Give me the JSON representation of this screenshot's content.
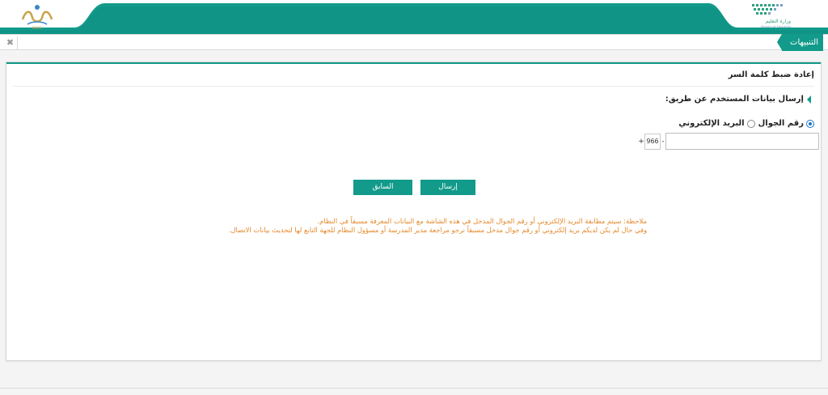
{
  "header": {
    "left_logo_label": "NOOR",
    "right_logo_ar": "وزارة التعليم",
    "right_logo_en": "Ministry of Education",
    "accent_color": "#129a8a"
  },
  "tabs": {
    "close_symbol": "✖",
    "active_tab_label": "التنبيهات"
  },
  "panel": {
    "title": "إعادة ضبط كلمة السر",
    "section_label": "إرسال بيانات المستخدم عن طريق:",
    "options": {
      "mobile": "رقم الجوال",
      "email": "البريد الإلكتروني"
    },
    "phone": {
      "plus": "+",
      "prefix": "966",
      "dash": "-",
      "value": "",
      "placeholder": ""
    },
    "buttons": {
      "send": "إرسال",
      "previous": "السابق"
    },
    "notes": [
      "ملاحظة: سيتم مطابقة البريد الإلكتروني أو رقم الجوال المدخل في هذه الشاشة مع البيانات المعرفة مسبقاً في النظام.",
      "وفي حال لم يكن لديكم بريد إلكتروني أو رقم جوال مدخل مسبقاً نرجو مراجعة مدير المدرسة أو مسؤول النظام للجهة التابع لها لتحديث بيانات الاتصال."
    ]
  }
}
